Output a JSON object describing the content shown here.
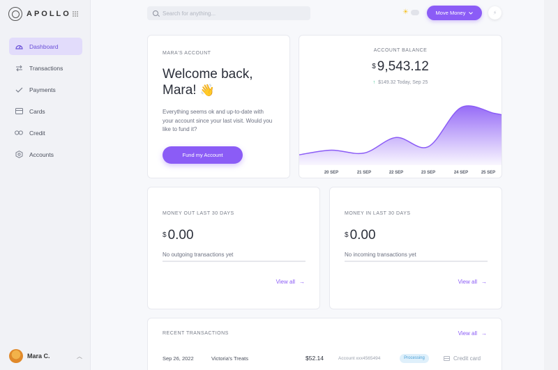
{
  "brand": {
    "name": "APOLLO"
  },
  "sidebar": {
    "items": [
      {
        "label": "Dashboard",
        "icon": "gauge-icon",
        "active": true
      },
      {
        "label": "Transactions",
        "icon": "swap-arrows-icon"
      },
      {
        "label": "Payments",
        "icon": "check-icon"
      },
      {
        "label": "Cards",
        "icon": "card-icon"
      },
      {
        "label": "Credit",
        "icon": "infinity-icon"
      },
      {
        "label": "Accounts",
        "icon": "hexagon-icon"
      }
    ],
    "user": {
      "name": "Mara C."
    }
  },
  "header": {
    "search_placeholder": "Search for anything...",
    "move_money_label": "Move Money"
  },
  "welcome": {
    "label": "MARA'S ACCOUNT",
    "title": "Welcome back, Mara!",
    "emoji": "👋",
    "message": "Everything seems ok and up-to-date with your account since your last visit. Would you like to fund it?",
    "button": "Fund my Account"
  },
  "balance": {
    "label": "ACCOUNT BALANCE",
    "currency": "$",
    "amount": "9,543.12",
    "delta": "$149.32 Today, Sep 25"
  },
  "chart_data": {
    "type": "area",
    "x": [
      "20 SEP",
      "21 SEP",
      "22 SEP",
      "23 SEP",
      "24 SEP",
      "25 SEP"
    ],
    "values": [
      26,
      21,
      48,
      32,
      100,
      90
    ],
    "ylim": [
      0,
      110
    ],
    "colors": {
      "line": "#8b5cf6",
      "fill_top": "#8b5cf6",
      "fill_bottom": "#ffffff"
    }
  },
  "money_out": {
    "label": "MONEY OUT LAST 30 DAYS",
    "currency": "$",
    "amount": "0.00",
    "note": "No outgoing transactions yet",
    "view_all": "View all"
  },
  "money_in": {
    "label": "MONEY IN LAST 30 DAYS",
    "currency": "$",
    "amount": "0.00",
    "note": "No incoming transactions yet",
    "view_all": "View all"
  },
  "recent": {
    "label": "RECENT TRANSACTIONS",
    "view_all": "View all",
    "rows": [
      {
        "date": "Sep 26, 2022",
        "merchant": "Victoria's Treats",
        "amount": "$52.14",
        "account": "Account xxx4565494",
        "status": "Processing",
        "method": "Credit card"
      }
    ]
  },
  "colors": {
    "accent": "#8b5cf6",
    "active_nav_bg": "#e2dcfb",
    "status_bg": "#dff0fb"
  }
}
